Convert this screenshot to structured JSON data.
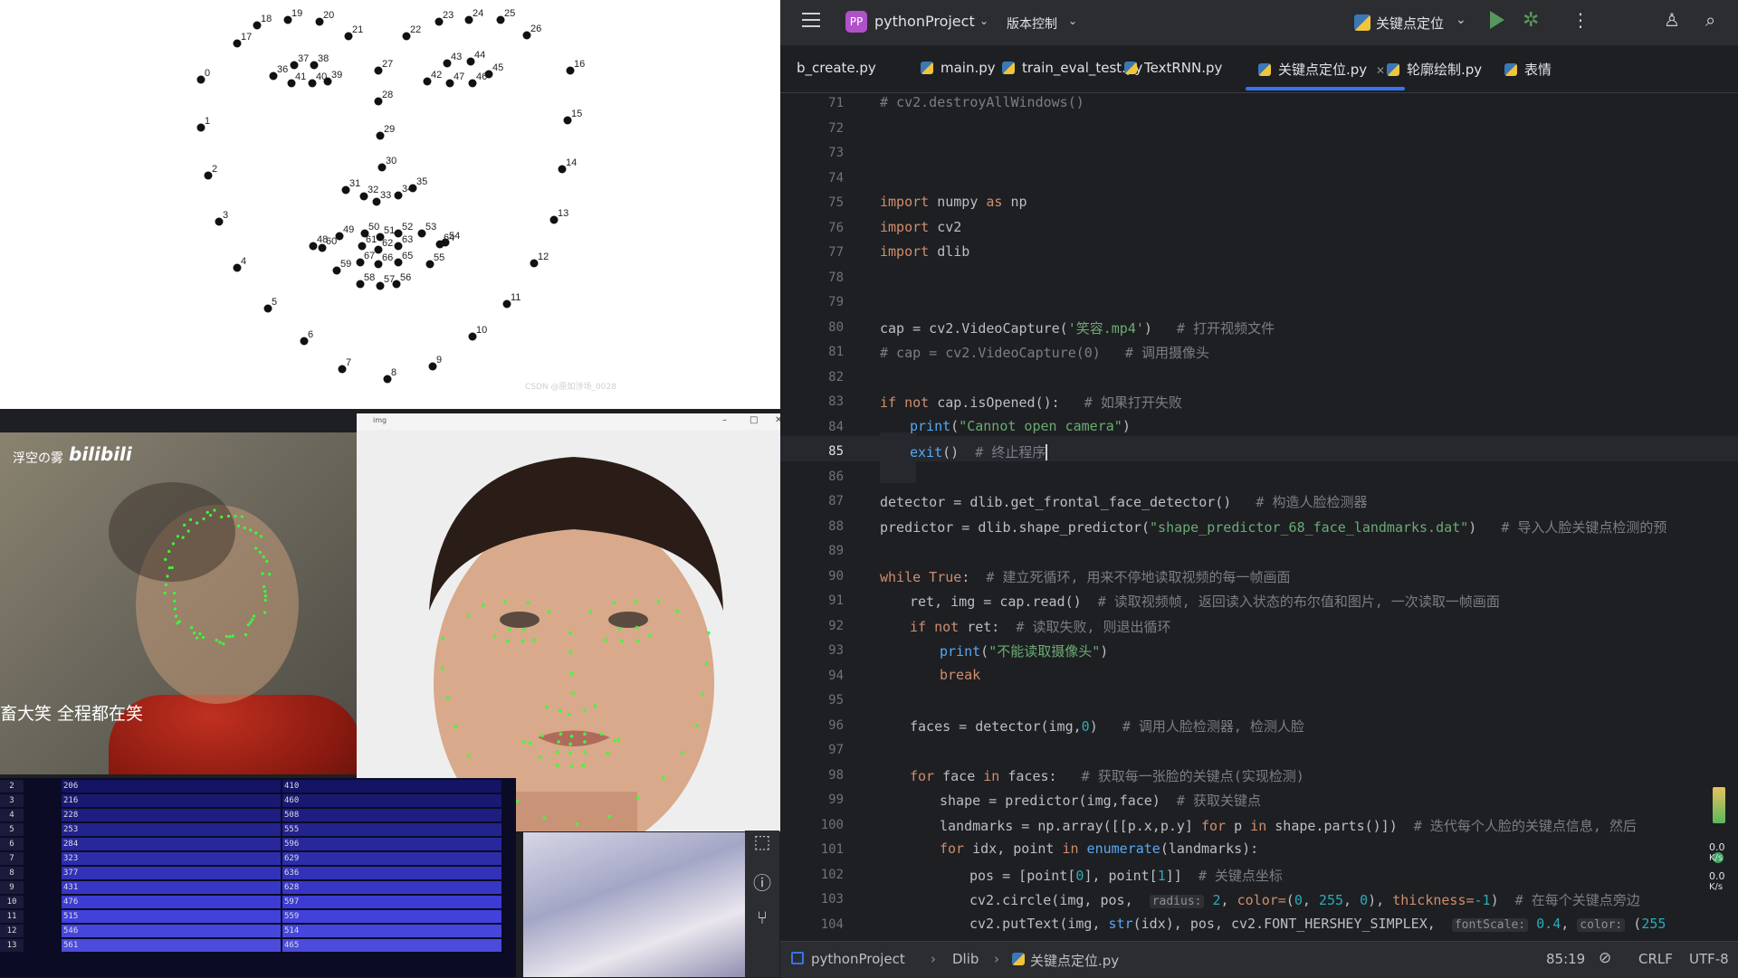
{
  "landmark_image": {
    "watermark": "CSDN @原如涉场_0028",
    "points": [
      {
        "label": "0"
      },
      {
        "label": "1"
      },
      {
        "label": "2"
      },
      {
        "label": "3"
      },
      {
        "label": "4"
      },
      {
        "label": "5"
      },
      {
        "label": "6"
      },
      {
        "label": "7"
      },
      {
        "label": "8"
      },
      {
        "label": "9"
      },
      {
        "label": "10"
      },
      {
        "label": "11"
      },
      {
        "label": "12"
      },
      {
        "label": "13"
      },
      {
        "label": "14"
      },
      {
        "label": "15"
      },
      {
        "label": "16"
      },
      {
        "label": "17"
      },
      {
        "label": "18"
      },
      {
        "label": "19"
      },
      {
        "label": "20"
      },
      {
        "label": "21"
      },
      {
        "label": "22"
      },
      {
        "label": "23"
      },
      {
        "label": "24"
      },
      {
        "label": "25"
      },
      {
        "label": "26"
      },
      {
        "label": "27"
      },
      {
        "label": "28"
      },
      {
        "label": "29"
      },
      {
        "label": "30"
      },
      {
        "label": "31"
      },
      {
        "label": "32"
      },
      {
        "label": "33"
      },
      {
        "label": "34"
      },
      {
        "label": "35"
      },
      {
        "label": "36"
      },
      {
        "label": "37"
      },
      {
        "label": "38"
      },
      {
        "label": "39"
      },
      {
        "label": "40"
      },
      {
        "label": "41"
      },
      {
        "label": "42"
      },
      {
        "label": "43"
      },
      {
        "label": "44"
      },
      {
        "label": "45"
      },
      {
        "label": "46"
      },
      {
        "label": "47"
      },
      {
        "label": "48"
      },
      {
        "label": "49"
      },
      {
        "label": "50"
      },
      {
        "label": "51"
      },
      {
        "label": "52"
      },
      {
        "label": "53"
      },
      {
        "label": "54"
      },
      {
        "label": "55"
      },
      {
        "label": "56"
      },
      {
        "label": "57"
      },
      {
        "label": "58"
      },
      {
        "label": "59"
      },
      {
        "label": "60"
      },
      {
        "label": "61"
      },
      {
        "label": "62"
      },
      {
        "label": "63"
      },
      {
        "label": "64"
      },
      {
        "label": "65"
      },
      {
        "label": "66"
      },
      {
        "label": "67"
      }
    ]
  },
  "video_frame": {
    "watermark": "浮空の雾",
    "logo": "bilibili",
    "caption": "畜大笑 全程都在笑"
  },
  "img_window": {
    "title": "img",
    "minimize": "–",
    "maximize": "□",
    "close": "✕"
  },
  "data_table": {
    "rows": [
      {
        "idx": "2",
        "a": "206",
        "b": "410"
      },
      {
        "idx": "3",
        "a": "216",
        "b": "460"
      },
      {
        "idx": "4",
        "a": "228",
        "b": "508"
      },
      {
        "idx": "5",
        "a": "253",
        "b": "555"
      },
      {
        "idx": "6",
        "a": "284",
        "b": "596"
      },
      {
        "idx": "7",
        "a": "323",
        "b": "629"
      },
      {
        "idx": "8",
        "a": "377",
        "b": "636"
      },
      {
        "idx": "9",
        "a": "431",
        "b": "628"
      },
      {
        "idx": "10",
        "a": "476",
        "b": "597"
      },
      {
        "idx": "11",
        "a": "515",
        "b": "559"
      },
      {
        "idx": "12",
        "a": "546",
        "b": "514"
      },
      {
        "idx": "13",
        "a": "561",
        "b": "465"
      }
    ]
  },
  "ide": {
    "menu_icon": "hamburger-icon",
    "project_badge": "PP",
    "project_name": "pythonProject",
    "vcs_label": "版本控制",
    "run_config": "关键点定位",
    "tabs": [
      {
        "label": "b_create.py"
      },
      {
        "label": "main.py"
      },
      {
        "label": "train_eval_test.py"
      },
      {
        "label": "TextRNN.py"
      },
      {
        "label": "关键点定位.py"
      },
      {
        "label": "轮廓绘制.py"
      },
      {
        "label": "表情"
      }
    ],
    "active_tab_index": 4,
    "line_numbers": [
      "71",
      "72",
      "73",
      "74",
      "75",
      "76",
      "77",
      "78",
      "79",
      "80",
      "81",
      "82",
      "83",
      "84",
      "85",
      "86",
      "87",
      "88",
      "89",
      "90",
      "91",
      "92",
      "93",
      "94",
      "95",
      "96",
      "97",
      "98",
      "99",
      "100",
      "101",
      "102",
      "103",
      "104"
    ],
    "code": {
      "l71": "# cv2.destroyAllWindows()",
      "l75a": "import",
      "l75b": " numpy ",
      "l75c": "as",
      "l75d": " np",
      "l76a": "import",
      "l76b": " cv2",
      "l77a": "import",
      "l77b": " dlib",
      "l80a": "cap = cv2.VideoCapture(",
      "l80b": "'笑容.mp4'",
      "l80c": ")   ",
      "l80d": "# 打开视频文件",
      "l81": "# cap = cv2.VideoCapture(0)   # 调用摄像头",
      "l83a": "if not",
      "l83b": " cap.isOpened():   ",
      "l83c": "# 如果打开失败",
      "l84a": "print",
      "l84b": "(",
      "l84c": "\"Cannot open camera\"",
      "l84d": ")",
      "l85a": "exit",
      "l85b": "()  ",
      "l85c": "# 终止程序",
      "l87a": "detector = dlib.get_frontal_face_detector()   ",
      "l87b": "# 构造人脸检测器",
      "l88a": "predictor = dlib.shape_predictor(",
      "l88b": "\"shape_predictor_68_face_landmarks.dat\"",
      "l88c": ")   ",
      "l88d": "# 导入人脸关键点检测的预",
      "l90a": "while",
      "l90b": " True",
      "l90c": ":  ",
      "l90d": "# 建立死循环, 用来不停地读取视频的每一帧画面",
      "l91a": "ret, img = cap.read()  ",
      "l91b": "# 读取视频帧, 返回读入状态的布尔值和图片, 一次读取一帧画面",
      "l92a": "if not",
      "l92b": " ret:  ",
      "l92c": "# 读取失败, 则退出循环",
      "l93a": "print",
      "l93b": "(",
      "l93c": "\"不能读取摄像头\"",
      "l93d": ")",
      "l94": "break",
      "l96a": "faces = detector(img,",
      "l96b": "0",
      "l96c": ")   ",
      "l96d": "# 调用人脸检测器, 检测人脸",
      "l98a": "for",
      "l98b": " face ",
      "l98c": "in",
      "l98d": " faces:   ",
      "l98e": "# 获取每一张脸的关键点(实现检测)",
      "l99a": "shape = predictor(img,face)  ",
      "l99b": "# 获取关键点",
      "l100a": "landmarks = np.array([[p.x,p.y] ",
      "l100b": "for",
      "l100c": " p ",
      "l100d": "in",
      "l100e": " shape.parts()])  ",
      "l100f": "# 迭代每个人脸的关键点信息, 然后",
      "l101a": "for",
      "l101b": " idx, point ",
      "l101c": "in",
      "l101d": " enumerate",
      "l101e": "(landmarks):",
      "l102a": "pos = [point[",
      "l102b": "0",
      "l102c": "], point[",
      "l102d": "1",
      "l102e": "]]  ",
      "l102f": "# 关键点坐标",
      "l103a": "cv2.circle(img, pos,  ",
      "l103h1": "radius:",
      "l103b": " ",
      "l103c": "2",
      "l103d": ", ",
      "l103h2": "color=",
      "l103e": "(",
      "l103f": "0",
      "l103g": ", ",
      "l103i": "255",
      "l103j": ", ",
      "l103k": "0",
      "l103l": "), ",
      "l103h3": "thickness=",
      "l103m": "-1",
      "l103n": ")  ",
      "l103o": "# 在每个关键点旁边",
      "l104a": "cv2.putText(img, ",
      "l104b": "str",
      "l104c": "(idx), pos, cv2.FONT_HERSHEY_SIMPLEX,  ",
      "l104h1": "fontScale:",
      "l104d": " ",
      "l104e": "0.4",
      "l104f": ", ",
      "l104h2": "color:",
      "l104g": " (",
      "l104i": "255"
    },
    "cursor_position": "85:19",
    "line_ending": "CRLF",
    "encoding": "UTF-8",
    "breadcrumb": [
      "pythonProject",
      "Dlib",
      "关键点定位.py"
    ],
    "net_speed_up": "0.0",
    "net_speed_unit": "K/s",
    "net_speed_down": "0.0",
    "net_speed_unit2": "K/s"
  },
  "colors": {
    "accent": "#3574f0",
    "green": "#57965c",
    "keyword": "#cf8e6d",
    "string": "#6aab73",
    "comment": "#7a7e85"
  }
}
